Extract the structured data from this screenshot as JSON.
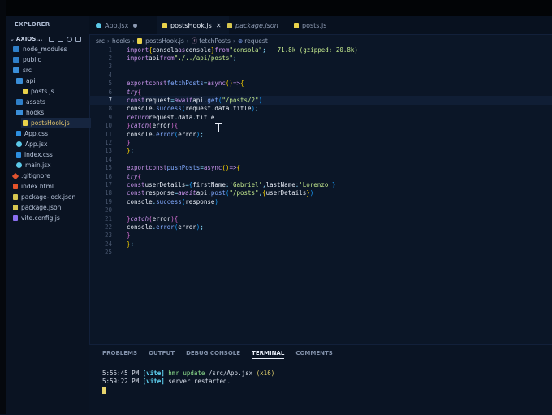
{
  "sidebar": {
    "title": "EXPLORER",
    "project": "AXIOS...",
    "items": [
      {
        "label": "node_modules",
        "icon": "folder-icon",
        "indent": 1
      },
      {
        "label": "public",
        "icon": "folder-icon",
        "indent": 1
      },
      {
        "label": "src",
        "icon": "folder-open-icon",
        "indent": 1
      },
      {
        "label": "api",
        "icon": "folder-open-icon",
        "indent": 2
      },
      {
        "label": "posts.js",
        "icon": "js-file-icon",
        "indent": 3
      },
      {
        "label": "assets",
        "icon": "folder-icon",
        "indent": 2
      },
      {
        "label": "hooks",
        "icon": "folder-open-icon",
        "indent": 2
      },
      {
        "label": "postsHook.js",
        "icon": "js-file-icon",
        "indent": 3
      },
      {
        "label": "App.css",
        "icon": "css-file-icon",
        "indent": 2
      },
      {
        "label": "App.jsx",
        "icon": "react-file-icon",
        "indent": 2
      },
      {
        "label": "index.css",
        "icon": "css-file-icon",
        "indent": 2
      },
      {
        "label": "main.jsx",
        "icon": "react-file-icon",
        "indent": 2
      },
      {
        "label": ".gitignore",
        "icon": "git-file-icon",
        "indent": 1
      },
      {
        "label": "index.html",
        "icon": "html-file-icon",
        "indent": 1
      },
      {
        "label": "package-lock.json",
        "icon": "json-file-icon",
        "indent": 1
      },
      {
        "label": "package.json",
        "icon": "json-file-icon",
        "indent": 1
      },
      {
        "label": "vite.config.js",
        "icon": "vite-file-icon",
        "indent": 1
      }
    ]
  },
  "tabs": [
    {
      "label": "App.jsx",
      "icon": "react-file-icon"
    },
    {
      "label": "postsHook.js",
      "icon": "js-file-icon",
      "close": "✕"
    },
    {
      "label": "package.json",
      "icon": "json-file-icon"
    },
    {
      "label": "posts.js",
      "icon": "js-file-icon"
    }
  ],
  "breadcrumb": [
    "src",
    "hooks",
    "postsHook.js",
    "fetchPosts",
    "request"
  ],
  "editor": {
    "current_line": 7,
    "line1_hint": "71.8k (gzipped: 20.8k)"
  },
  "panel": {
    "tabs": [
      "PROBLEMS",
      "OUTPUT",
      "DEBUG CONSOLE",
      "TERMINAL",
      "COMMENTS"
    ],
    "active_tab": "TERMINAL",
    "terminal": [
      {
        "time": "5:56:45 PM",
        "tag": "[vite]",
        "message": "hmr update",
        "detail": " /src/App.jsx",
        "count": "(x16)"
      },
      {
        "time": "5:59:22 PM",
        "tag": "[vite]",
        "message": "server restarted.",
        "detail": "",
        "count": ""
      }
    ]
  },
  "colors": {
    "background": "#0b1627",
    "keyword": "#c792ea",
    "function": "#82aaff",
    "string": "#c3e88d",
    "vite_tag": "#5fd3f3"
  }
}
